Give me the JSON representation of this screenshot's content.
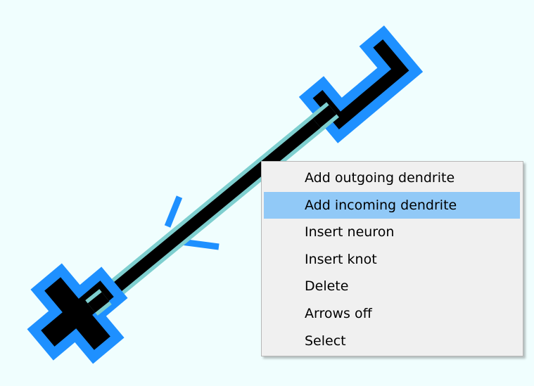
{
  "colors": {
    "background": "#f0fefe",
    "node_outline": "#1e90ff",
    "node_fill": "#000000",
    "edge_highlight": "#7ecfcf",
    "menu_bg": "#f0f0f0",
    "menu_highlight": "#91c9f7"
  },
  "context_menu": {
    "highlighted_index": 1,
    "items": [
      {
        "label": "Add outgoing dendrite"
      },
      {
        "label": "Add incoming dendrite"
      },
      {
        "label": "Insert neuron"
      },
      {
        "label": "Insert knot"
      },
      {
        "label": "Delete"
      },
      {
        "label": "Arrows off"
      },
      {
        "label": "Select"
      }
    ]
  }
}
